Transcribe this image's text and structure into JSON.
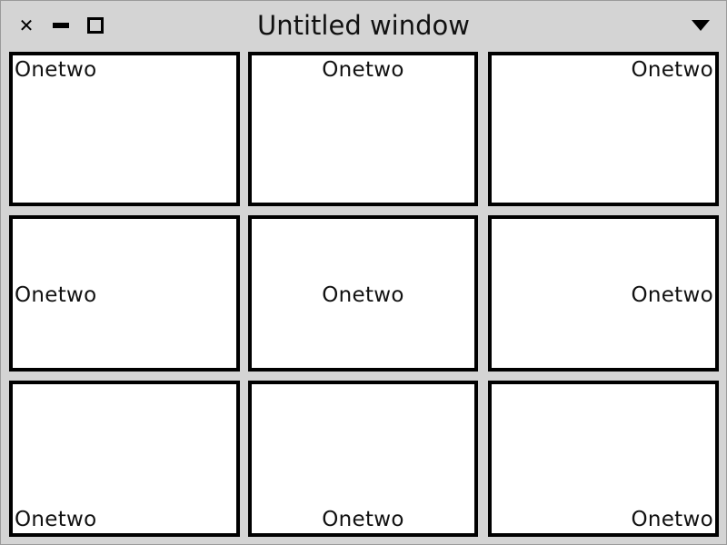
{
  "window": {
    "title": "Untitled window",
    "buttons": {
      "close_icon": "close-icon",
      "minimize_icon": "minimize-icon",
      "maximize_icon": "maximize-icon",
      "menu_icon": "window-menu-icon"
    }
  },
  "cells": [
    {
      "label": "Onetwo",
      "alignment": "top-left"
    },
    {
      "label": "Onetwo",
      "alignment": "top-center"
    },
    {
      "label": "Onetwo",
      "alignment": "top-right"
    },
    {
      "label": "Onetwo",
      "alignment": "middle-left"
    },
    {
      "label": "Onetwo",
      "alignment": "middle-center"
    },
    {
      "label": "Onetwo",
      "alignment": "middle-right"
    },
    {
      "label": "Onetwo",
      "alignment": "bottom-left"
    },
    {
      "label": "Onetwo",
      "alignment": "bottom-center"
    },
    {
      "label": "Onetwo",
      "alignment": "bottom-right"
    }
  ],
  "colors": {
    "window_background": "#d4d4d4",
    "cell_background": "#ffffff",
    "cell_border": "#000000"
  }
}
